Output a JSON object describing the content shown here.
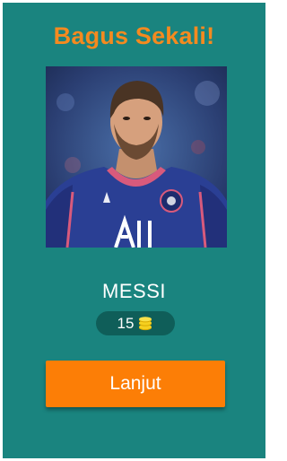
{
  "dialog": {
    "title": "Bagus Sekali!",
    "answer": "MESSI",
    "reward": {
      "amount": "15",
      "icon": "coin-stack-icon"
    },
    "next_button_label": "Lanjut"
  },
  "colors": {
    "background": "#1a847f",
    "title": "#f58a1f",
    "button": "#fc7e06",
    "pill": "#0f5e59",
    "coin": "#f5d020"
  }
}
